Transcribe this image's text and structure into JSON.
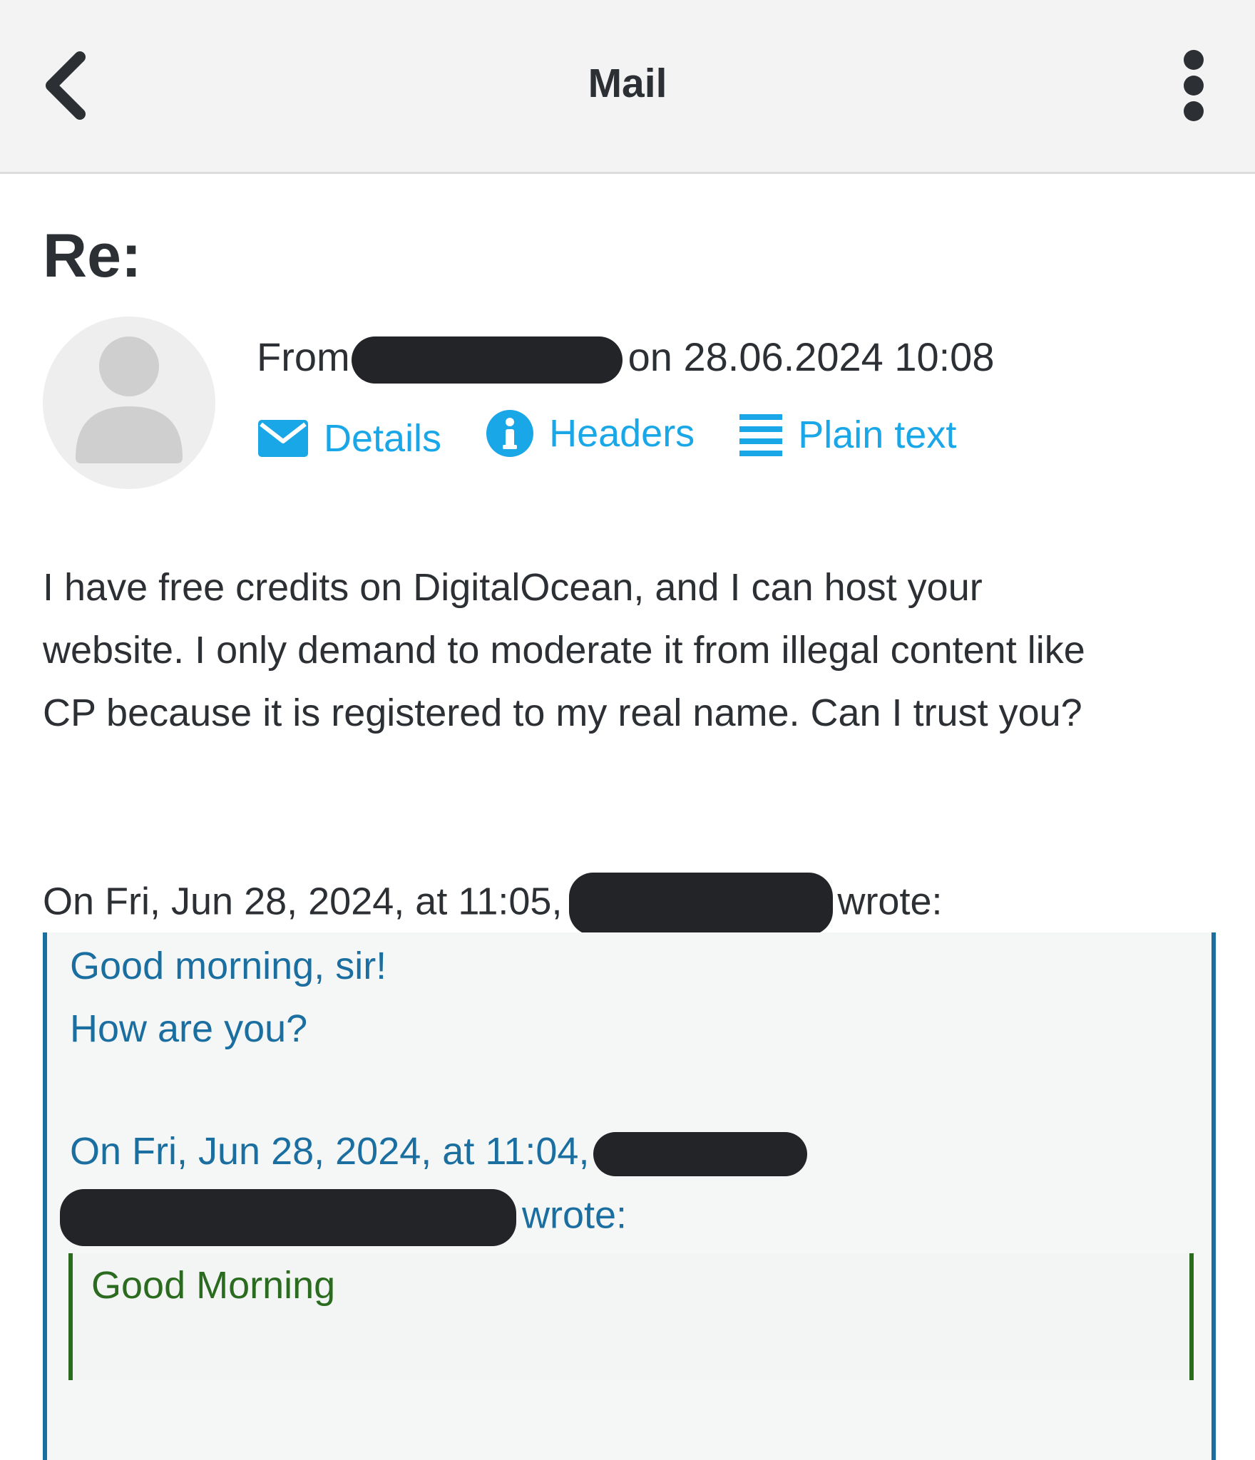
{
  "topbar": {
    "title": "Mail",
    "back_icon": "chevron-left-icon",
    "menu_icon": "more-vertical-icon"
  },
  "message": {
    "subject": "Re:",
    "from_prefix": "From",
    "from_suffix": "on 28.06.2024 10:08",
    "actions": [
      {
        "label": "Details",
        "icon": "envelope-icon"
      },
      {
        "label": "Headers",
        "icon": "info-icon"
      },
      {
        "label": "Plain text",
        "icon": "lines-icon"
      }
    ],
    "body_lines": [
      "I have free credits on DigitalOcean, and I can host your",
      "website. I only demand to moderate it from illegal content like",
      "CP because it is registered to my real name. Can I trust you?"
    ]
  },
  "quote": {
    "intro_prefix": "On Fri, Jun 28, 2024, at 11:05,",
    "intro_suffix": "wrote:",
    "line1": "Good morning, sir!",
    "line2": "How are you?",
    "nested_intro_prefix": "On Fri, Jun 28, 2024, at 11:04,",
    "nested_intro_suffix": "wrote:",
    "nested_text": "Good Morning"
  },
  "colors": {
    "accent": "#1aa7e8",
    "quote1": "#1b6fa0",
    "quote2": "#2a6b1f",
    "text": "#2c2f33"
  }
}
